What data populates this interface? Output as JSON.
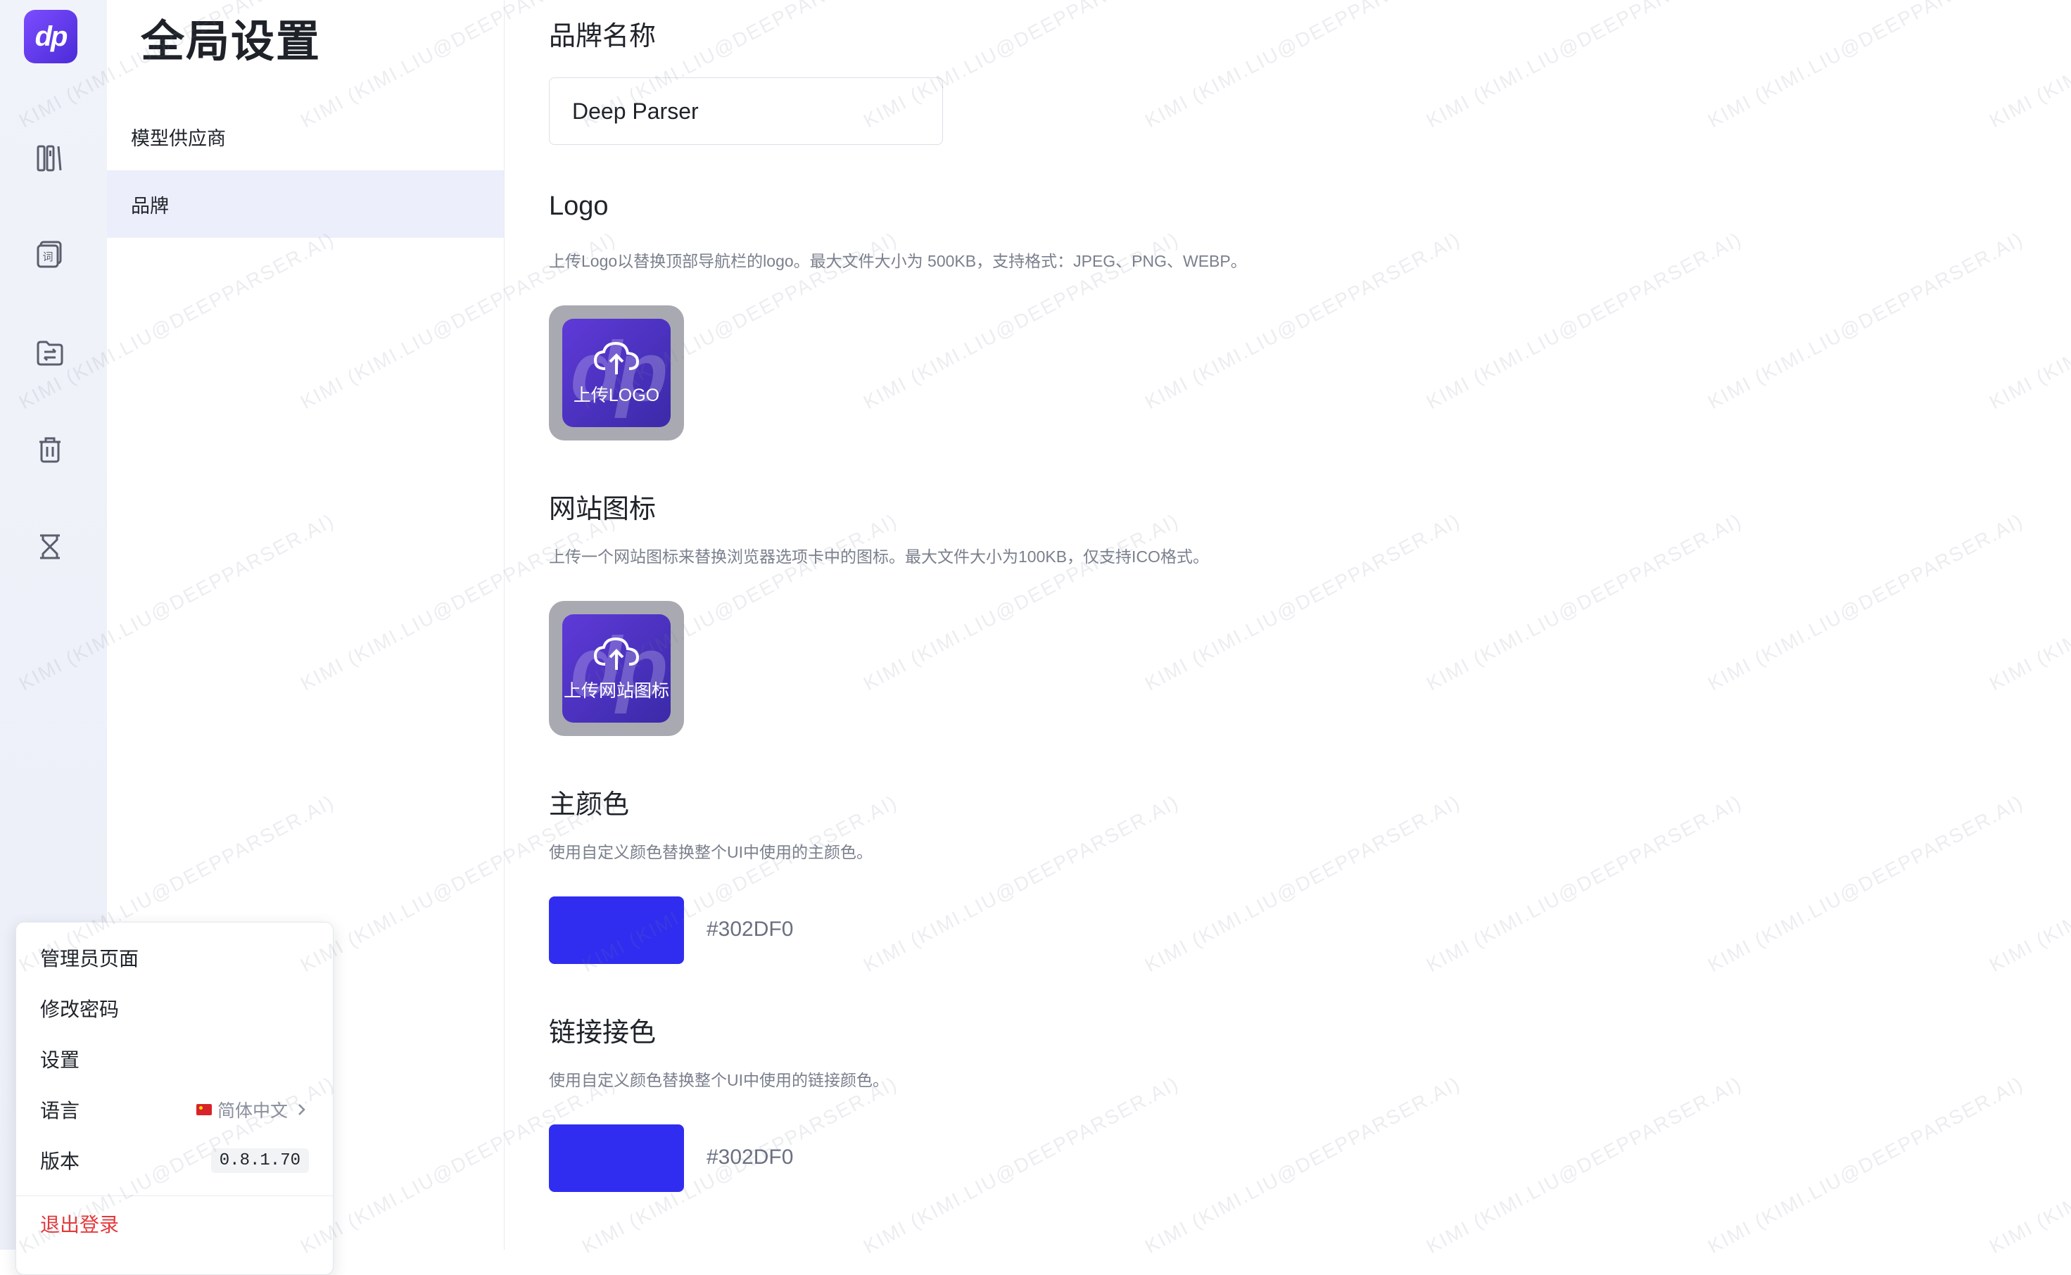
{
  "app": {
    "logo_text": "dp"
  },
  "rail": {
    "icons": [
      "library-icon",
      "glossary-icon",
      "folder-transfer-icon",
      "trash-icon",
      "hourglass-icon"
    ]
  },
  "nav": {
    "title": "全局设置",
    "items": [
      {
        "label": "模型供应商",
        "active": false
      },
      {
        "label": "品牌",
        "active": true
      }
    ]
  },
  "brand": {
    "name_title": "品牌名称",
    "name_value": "Deep Parser",
    "logo_title": "Logo",
    "logo_desc": "上传Logo以替换顶部导航栏的logo。最大文件大小为 500KB，支持格式：JPEG、PNG、WEBP。",
    "logo_upload_label": "上传LOGO",
    "favicon_title": "网站图标",
    "favicon_desc": "上传一个网站图标来替换浏览器选项卡中的图标。最大文件大小为100KB，仅支持ICO格式。",
    "favicon_upload_label": "上传网站图标",
    "primary_title": "主颜色",
    "primary_desc": "使用自定义颜色替换整个UI中使用的主颜色。",
    "primary_color": "#302DF0",
    "primary_hex": "#302DF0",
    "link_title": "链接接色",
    "link_desc": "使用自定义颜色替换整个UI中使用的链接颜色。",
    "link_color": "#302DF0",
    "link_hex": "#302DF0"
  },
  "menu": {
    "admin": "管理员页面",
    "change_password": "修改密码",
    "settings": "设置",
    "language_label": "语言",
    "language_value": "简体中文",
    "version_label": "版本",
    "version_value": "0.8.1.70",
    "logout": "退出登录"
  },
  "watermark": "KIMI (KIMI.LIU@DEEPPARSER.AI)"
}
